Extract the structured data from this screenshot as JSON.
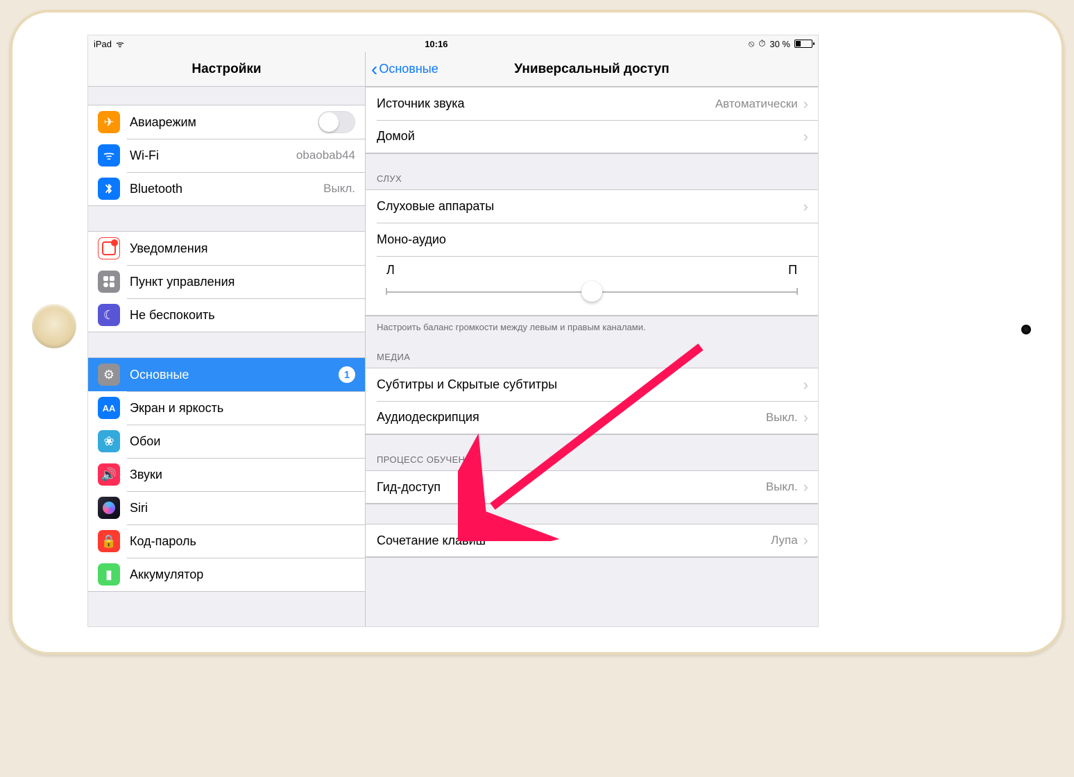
{
  "status": {
    "device": "iPad",
    "time": "10:16",
    "battery_text": "30 %",
    "lock_icon": "⊘",
    "alarm_icon": "⏰"
  },
  "sidebar": {
    "title": "Настройки",
    "groups": [
      [
        {
          "label": "Авиарежим",
          "icon_name": "airplane-icon",
          "bg": "bg-orange",
          "glyph": "✈",
          "type": "switch",
          "value": ""
        },
        {
          "label": "Wi-Fi",
          "icon_name": "wifi-icon",
          "bg": "bg-blue",
          "glyph": "ᯤ",
          "type": "value",
          "value": "obaobab44"
        },
        {
          "label": "Bluetooth",
          "icon_name": "bluetooth-icon",
          "bg": "bg-blue",
          "glyph": "⌵",
          "type": "value",
          "value": "Выкл."
        }
      ],
      [
        {
          "label": "Уведомления",
          "icon_name": "notifications-icon",
          "bg": "bg-red",
          "glyph": "◻",
          "type": "link",
          "value": ""
        },
        {
          "label": "Пункт управления",
          "icon_name": "control-center-icon",
          "bg": "bg-grey",
          "glyph": "◉",
          "type": "link",
          "value": ""
        },
        {
          "label": "Не беспокоить",
          "icon_name": "dnd-icon",
          "bg": "bg-purple",
          "glyph": "☾",
          "type": "link",
          "value": ""
        }
      ],
      [
        {
          "label": "Основные",
          "icon_name": "gear-icon",
          "bg": "bg-gear",
          "glyph": "⚙",
          "type": "badge",
          "value": "1",
          "selected": true
        },
        {
          "label": "Экран и яркость",
          "icon_name": "brightness-icon",
          "bg": "bg-brightness",
          "glyph": "AA",
          "type": "link",
          "value": ""
        },
        {
          "label": "Обои",
          "icon_name": "wallpaper-icon",
          "bg": "bg-wallpaper",
          "glyph": "❀",
          "type": "link",
          "value": ""
        },
        {
          "label": "Звуки",
          "icon_name": "sounds-icon",
          "bg": "bg-sound",
          "glyph": "🔊",
          "type": "link",
          "value": ""
        },
        {
          "label": "Siri",
          "icon_name": "siri-icon",
          "bg": "",
          "glyph": "",
          "type": "link",
          "value": ""
        },
        {
          "label": "Код-пароль",
          "icon_name": "passcode-icon",
          "bg": "bg-lock",
          "glyph": "🔒",
          "type": "link",
          "value": ""
        },
        {
          "label": "Аккумулятор",
          "icon_name": "battery-icon",
          "bg": "bg-battery",
          "glyph": "▮",
          "type": "link",
          "value": ""
        }
      ]
    ]
  },
  "detail": {
    "back_label": "Основные",
    "title": "Универсальный доступ",
    "first_group": [
      {
        "label": "Источник звука",
        "value": "Автоматически",
        "chevron": true
      },
      {
        "label": "Домой",
        "value": "",
        "chevron": true
      }
    ],
    "hearing": {
      "header": "СЛУХ",
      "rows": {
        "hearing_aids": {
          "label": "Слуховые аппараты",
          "chevron": true
        },
        "mono_audio": {
          "label": "Моно-аудио",
          "switch": true
        },
        "balance": {
          "left": "Л",
          "right": "П"
        }
      },
      "footer": "Настроить баланс громкости между левым и правым каналами."
    },
    "media": {
      "header": "МЕДИА",
      "rows": [
        {
          "label": "Субтитры и Скрытые субтитры",
          "value": "",
          "chevron": true
        },
        {
          "label": "Аудиодескрипция",
          "value": "Выкл.",
          "chevron": true
        }
      ]
    },
    "learning": {
      "header": "ПРОЦЕСС ОБУЧЕНИЯ",
      "rows": [
        {
          "label": "Гид-доступ",
          "value": "Выкл.",
          "chevron": true
        }
      ]
    },
    "shortcut": {
      "rows": [
        {
          "label": "Сочетание клавиш",
          "value": "Лупа",
          "chevron": true
        }
      ]
    }
  },
  "annotation": {
    "type": "arrow",
    "color": "#ff1255"
  }
}
